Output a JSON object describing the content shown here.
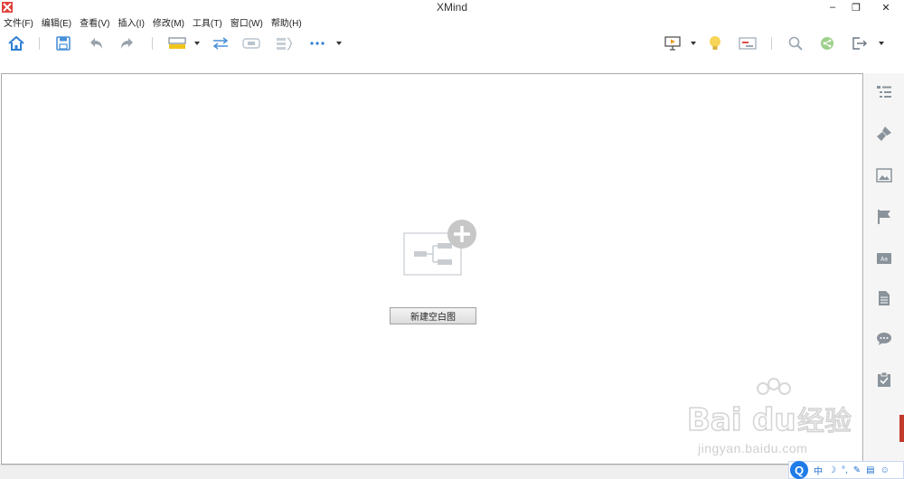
{
  "window": {
    "title": "XMind",
    "minimize_glyph": "–",
    "restore_glyph": "❐",
    "close_glyph": "✕"
  },
  "menu": [
    {
      "label": "文件(F)"
    },
    {
      "label": "编辑(E)"
    },
    {
      "label": "查看(V)"
    },
    {
      "label": "插入(I)"
    },
    {
      "label": "修改(M)"
    },
    {
      "label": "工具(T)"
    },
    {
      "label": "窗口(W)"
    },
    {
      "label": "帮助(H)"
    }
  ],
  "toolbar": {
    "icons": [
      "home-icon",
      "save-icon",
      "undo-icon",
      "redo-icon",
      "topic-icon",
      "relationship-icon",
      "boundary-icon",
      "summary-icon",
      "more-icon",
      "presentation-icon",
      "idea-icon",
      "gantt-icon",
      "search-icon",
      "share-icon",
      "export-icon"
    ]
  },
  "canvas": {
    "new_blank_label": "新建空白图"
  },
  "sidepanel": {
    "icons": [
      "outline-icon",
      "format-brush-icon",
      "image-icon",
      "marker-flag-icon",
      "style-icon",
      "notes-icon",
      "comments-icon",
      "task-icon"
    ]
  },
  "watermark": {
    "brand": "Bai du 经验",
    "url": "jingyan.baidu.com"
  },
  "ime": {
    "logo": "Q",
    "lang": "中",
    "items": [
      "☽",
      "°,",
      "✎",
      "▤",
      "☺"
    ]
  },
  "colors": {
    "accent_blue": "#1e6fcf",
    "toolbar_icon_gray": "#9aa7b3",
    "logo_red": "#e2413a"
  }
}
